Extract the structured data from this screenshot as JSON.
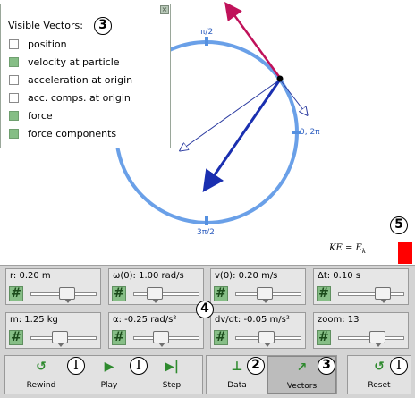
{
  "vectors_panel": {
    "title": "Visible Vectors:",
    "items": [
      {
        "label": "position",
        "checked": false
      },
      {
        "label": "velocity at particle",
        "checked": true
      },
      {
        "label": "acceleration at origin",
        "checked": false
      },
      {
        "label": "acc. comps. at origin",
        "checked": false
      },
      {
        "label": "force",
        "checked": true
      },
      {
        "label": "force components",
        "checked": true
      }
    ]
  },
  "canvas": {
    "angle_top": "π/2",
    "angle_right": "0, 2π",
    "angle_bottom": "3π/2",
    "circle_color": "#6aa0e8",
    "tick_color": "#5590e0"
  },
  "energy": {
    "label": "KE = E",
    "label_sub": "k",
    "bar_color": "#ff0000"
  },
  "callouts": {
    "vectors_panel": "3",
    "params": "4",
    "energy": "5",
    "rewind": "I",
    "play": "I",
    "data": "2",
    "vectors": "3",
    "reset": "I"
  },
  "params": [
    {
      "label": "r: 0.20 m",
      "pos": 0.55
    },
    {
      "label": "ω(0): 1.00 rad/s",
      "pos": 0.32
    },
    {
      "label": "v(0): 0.20 m/s",
      "pos": 0.45
    },
    {
      "label": "Δt: 0.10 s",
      "pos": 0.68
    },
    {
      "label": "m: 1.25 kg",
      "pos": 0.45
    },
    {
      "label": "α: -0.25 rad/s²",
      "pos": 0.42
    },
    {
      "label": "dv/dt: -0.05 m/s²",
      "pos": 0.47
    },
    {
      "label": "zoom: 13",
      "pos": 0.6
    }
  ],
  "buttons": {
    "rewind": "Rewind",
    "play": "Play",
    "step": "Step",
    "data": "Data",
    "vectors": "Vectors",
    "reset": "Reset"
  },
  "icons": {
    "rewind": "rewind-icon",
    "play": "play-icon",
    "step": "step-icon",
    "data": "data-icon",
    "vectors": "vectors-icon",
    "reset": "reset-icon"
  }
}
